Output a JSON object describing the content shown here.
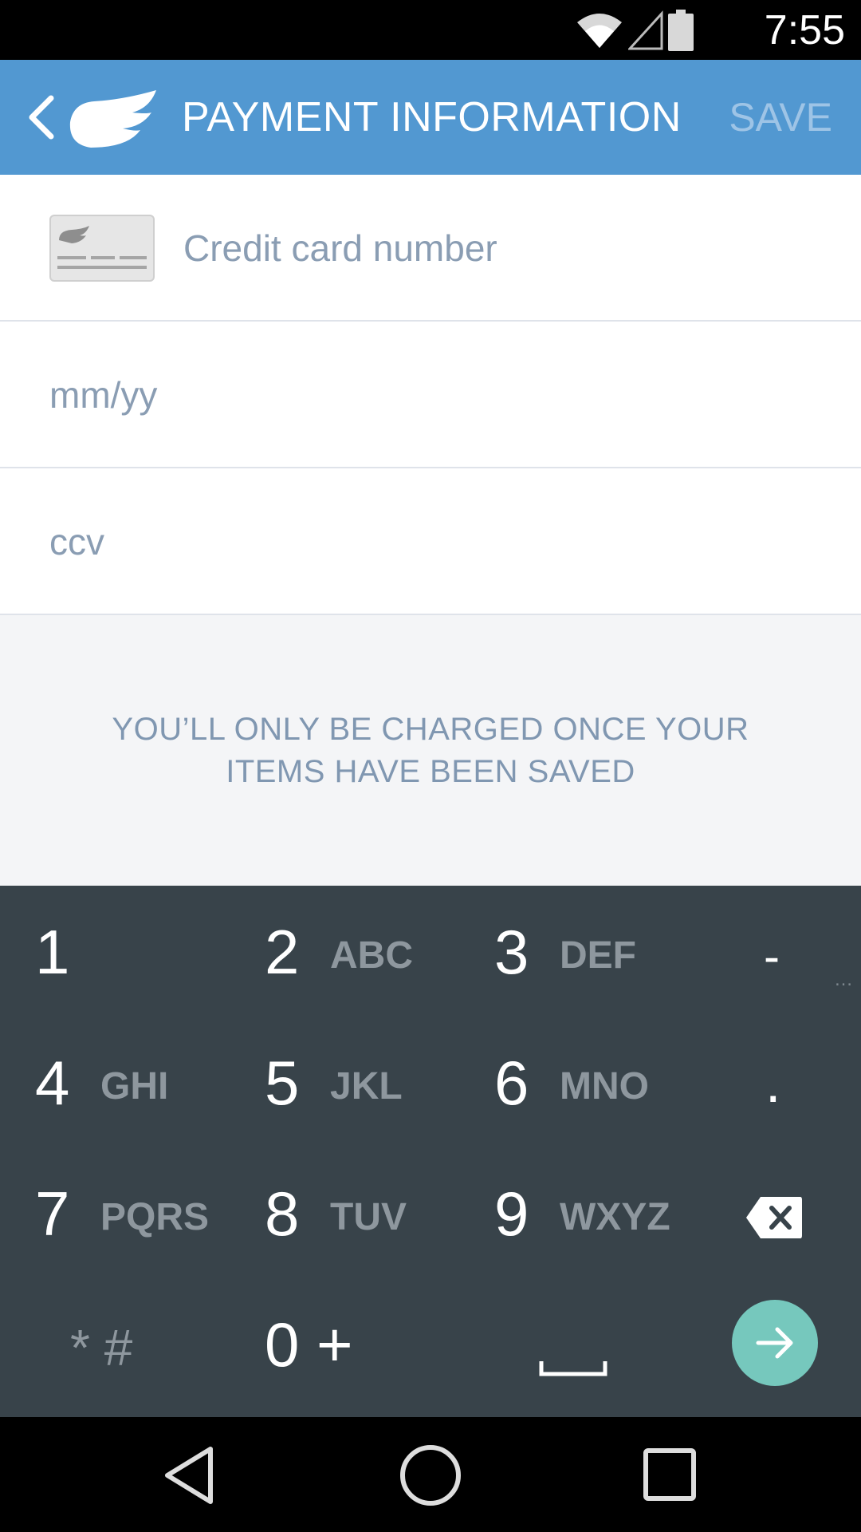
{
  "status_bar": {
    "time": "7:55",
    "icons": [
      "wifi-icon",
      "cell-signal-icon",
      "battery-icon"
    ]
  },
  "app_bar": {
    "title": "PAYMENT INFORMATION",
    "save_label": "SAVE",
    "back_icon": "chevron-left-icon",
    "logo_icon": "wing-logo-icon"
  },
  "form": {
    "card_number_placeholder": "Credit card number",
    "expiry_placeholder": "mm/yy",
    "ccv_placeholder": "ccv"
  },
  "notice": {
    "line1": "YOU’LL ONLY BE CHARGED ONCE YOUR",
    "line2": "ITEMS HAVE BEEN SAVED"
  },
  "keypad": {
    "keys": [
      {
        "num": "1",
        "letters": ""
      },
      {
        "num": "2",
        "letters": "ABC"
      },
      {
        "num": "3",
        "letters": "DEF"
      },
      {
        "num": "-",
        "letters": ""
      },
      {
        "num": "4",
        "letters": "GHI"
      },
      {
        "num": "5",
        "letters": "JKL"
      },
      {
        "num": "6",
        "letters": "MNO"
      },
      {
        "num": ".",
        "letters": ""
      },
      {
        "num": "7",
        "letters": "PQRS"
      },
      {
        "num": "8",
        "letters": "TUV"
      },
      {
        "num": "9",
        "letters": "WXYZ"
      },
      {
        "num": "",
        "letters": ""
      },
      {
        "num": "* #",
        "letters": ""
      },
      {
        "num": "0 +",
        "letters": ""
      },
      {
        "num": "",
        "letters": ""
      },
      {
        "num": "",
        "letters": ""
      }
    ],
    "backspace_icon": "backspace-icon",
    "space_icon": "space-bar-icon",
    "go_icon": "arrow-right-icon",
    "go_color": "#76c8bd"
  },
  "nav_bar": {
    "icons": [
      "back-triangle-icon",
      "home-circle-icon",
      "recents-square-icon"
    ]
  },
  "colors": {
    "app_bar": "#5298d1",
    "keypad_bg": "#38434a",
    "placeholder": "#8a9db3"
  }
}
